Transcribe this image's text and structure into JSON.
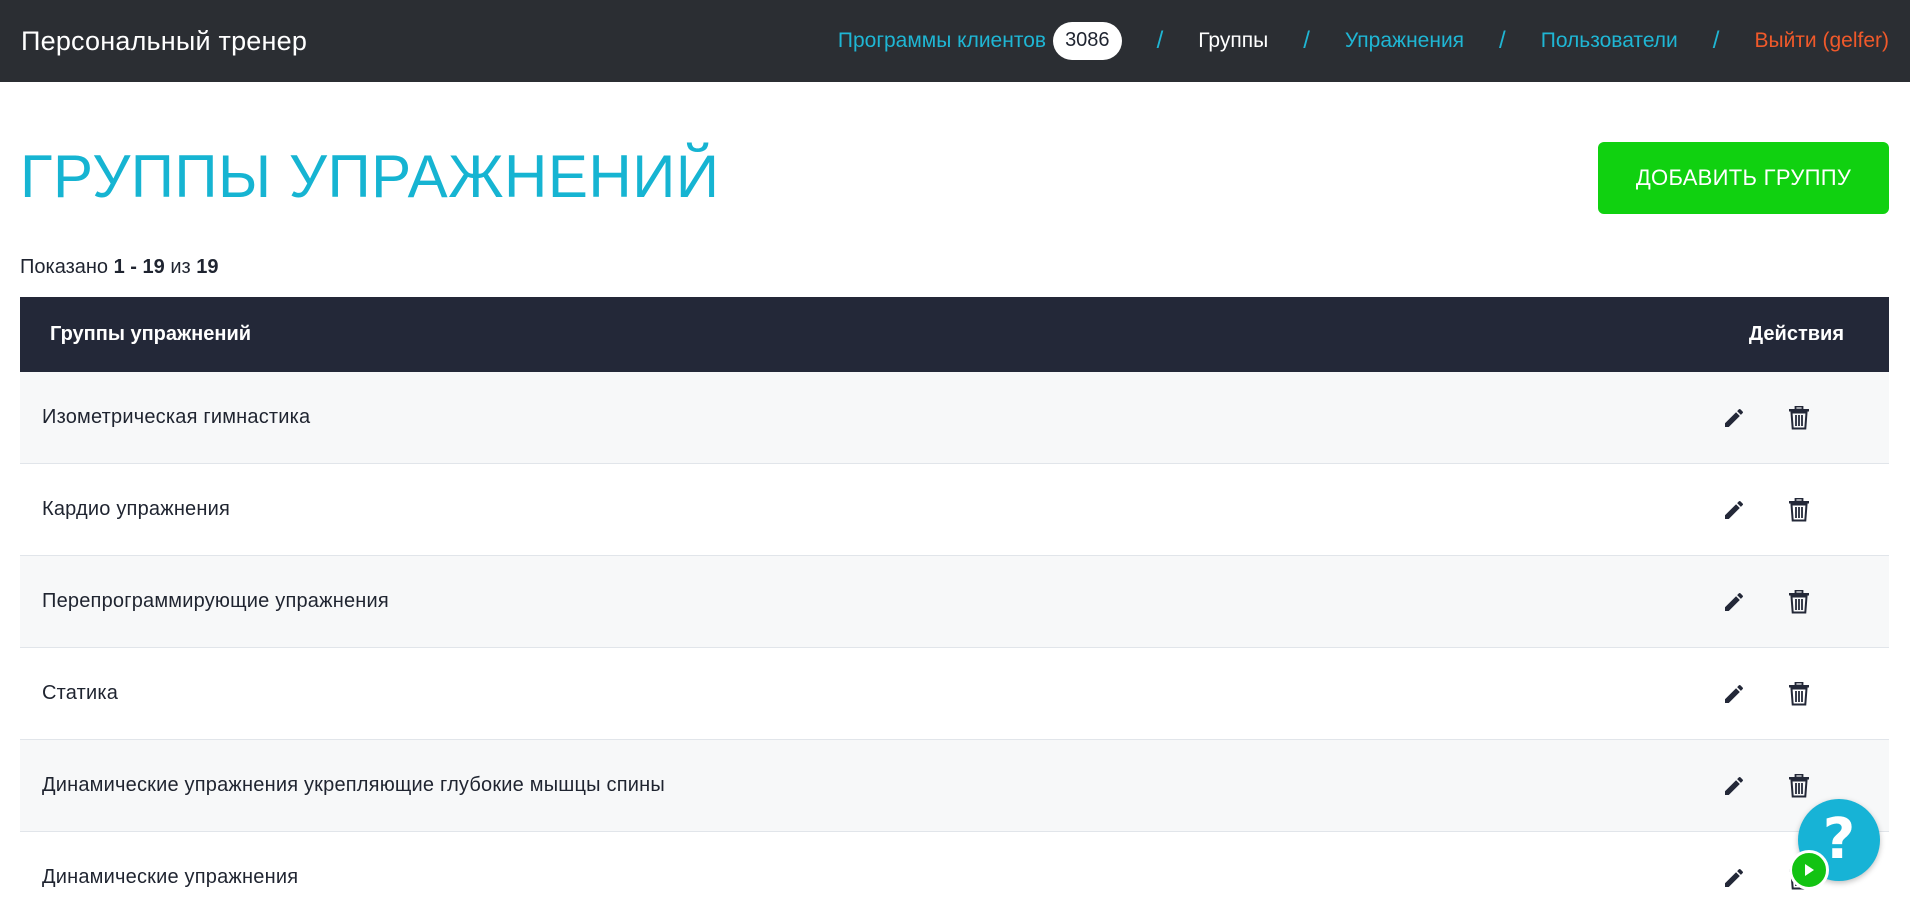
{
  "header": {
    "brand": "Персональный тренер",
    "nav": {
      "programs_label": "Программы клиентов",
      "programs_count": "3086",
      "separator": "/",
      "groups_label": "Группы",
      "exercises_label": "Упражнения",
      "users_label": "Пользователи",
      "logout_label": "Выйти (gelfer)"
    }
  },
  "page": {
    "title": "ГРУППЫ УПРАЖНЕНИЙ",
    "add_button_label": "ДОБАВИТЬ ГРУППУ",
    "showing": {
      "prefix": "Показано",
      "range": "1 - 19",
      "of": "из",
      "total": "19"
    }
  },
  "table": {
    "columns": {
      "name": "Группы упражнений",
      "actions": "Действия"
    },
    "rows": [
      "Изометрическая гимнастика",
      "Кардио упражнения",
      "Перепрограммирующие упражнения",
      "Статика",
      "Динамические упражнения укрепляющие глубокие мышцы спины",
      "Динамические упражнения"
    ]
  },
  "icons": {
    "edit": "pencil-icon",
    "delete": "trash-icon",
    "help": "question-icon",
    "play": "play-icon"
  },
  "colors": {
    "navbar_bg": "#2b2e33",
    "nav_link": "#1fb6d4",
    "logout": "#f0592a",
    "title": "#16b4d2",
    "add_button": "#10d110",
    "table_header_bg": "#232838",
    "help_fab": "#17b3d6"
  }
}
